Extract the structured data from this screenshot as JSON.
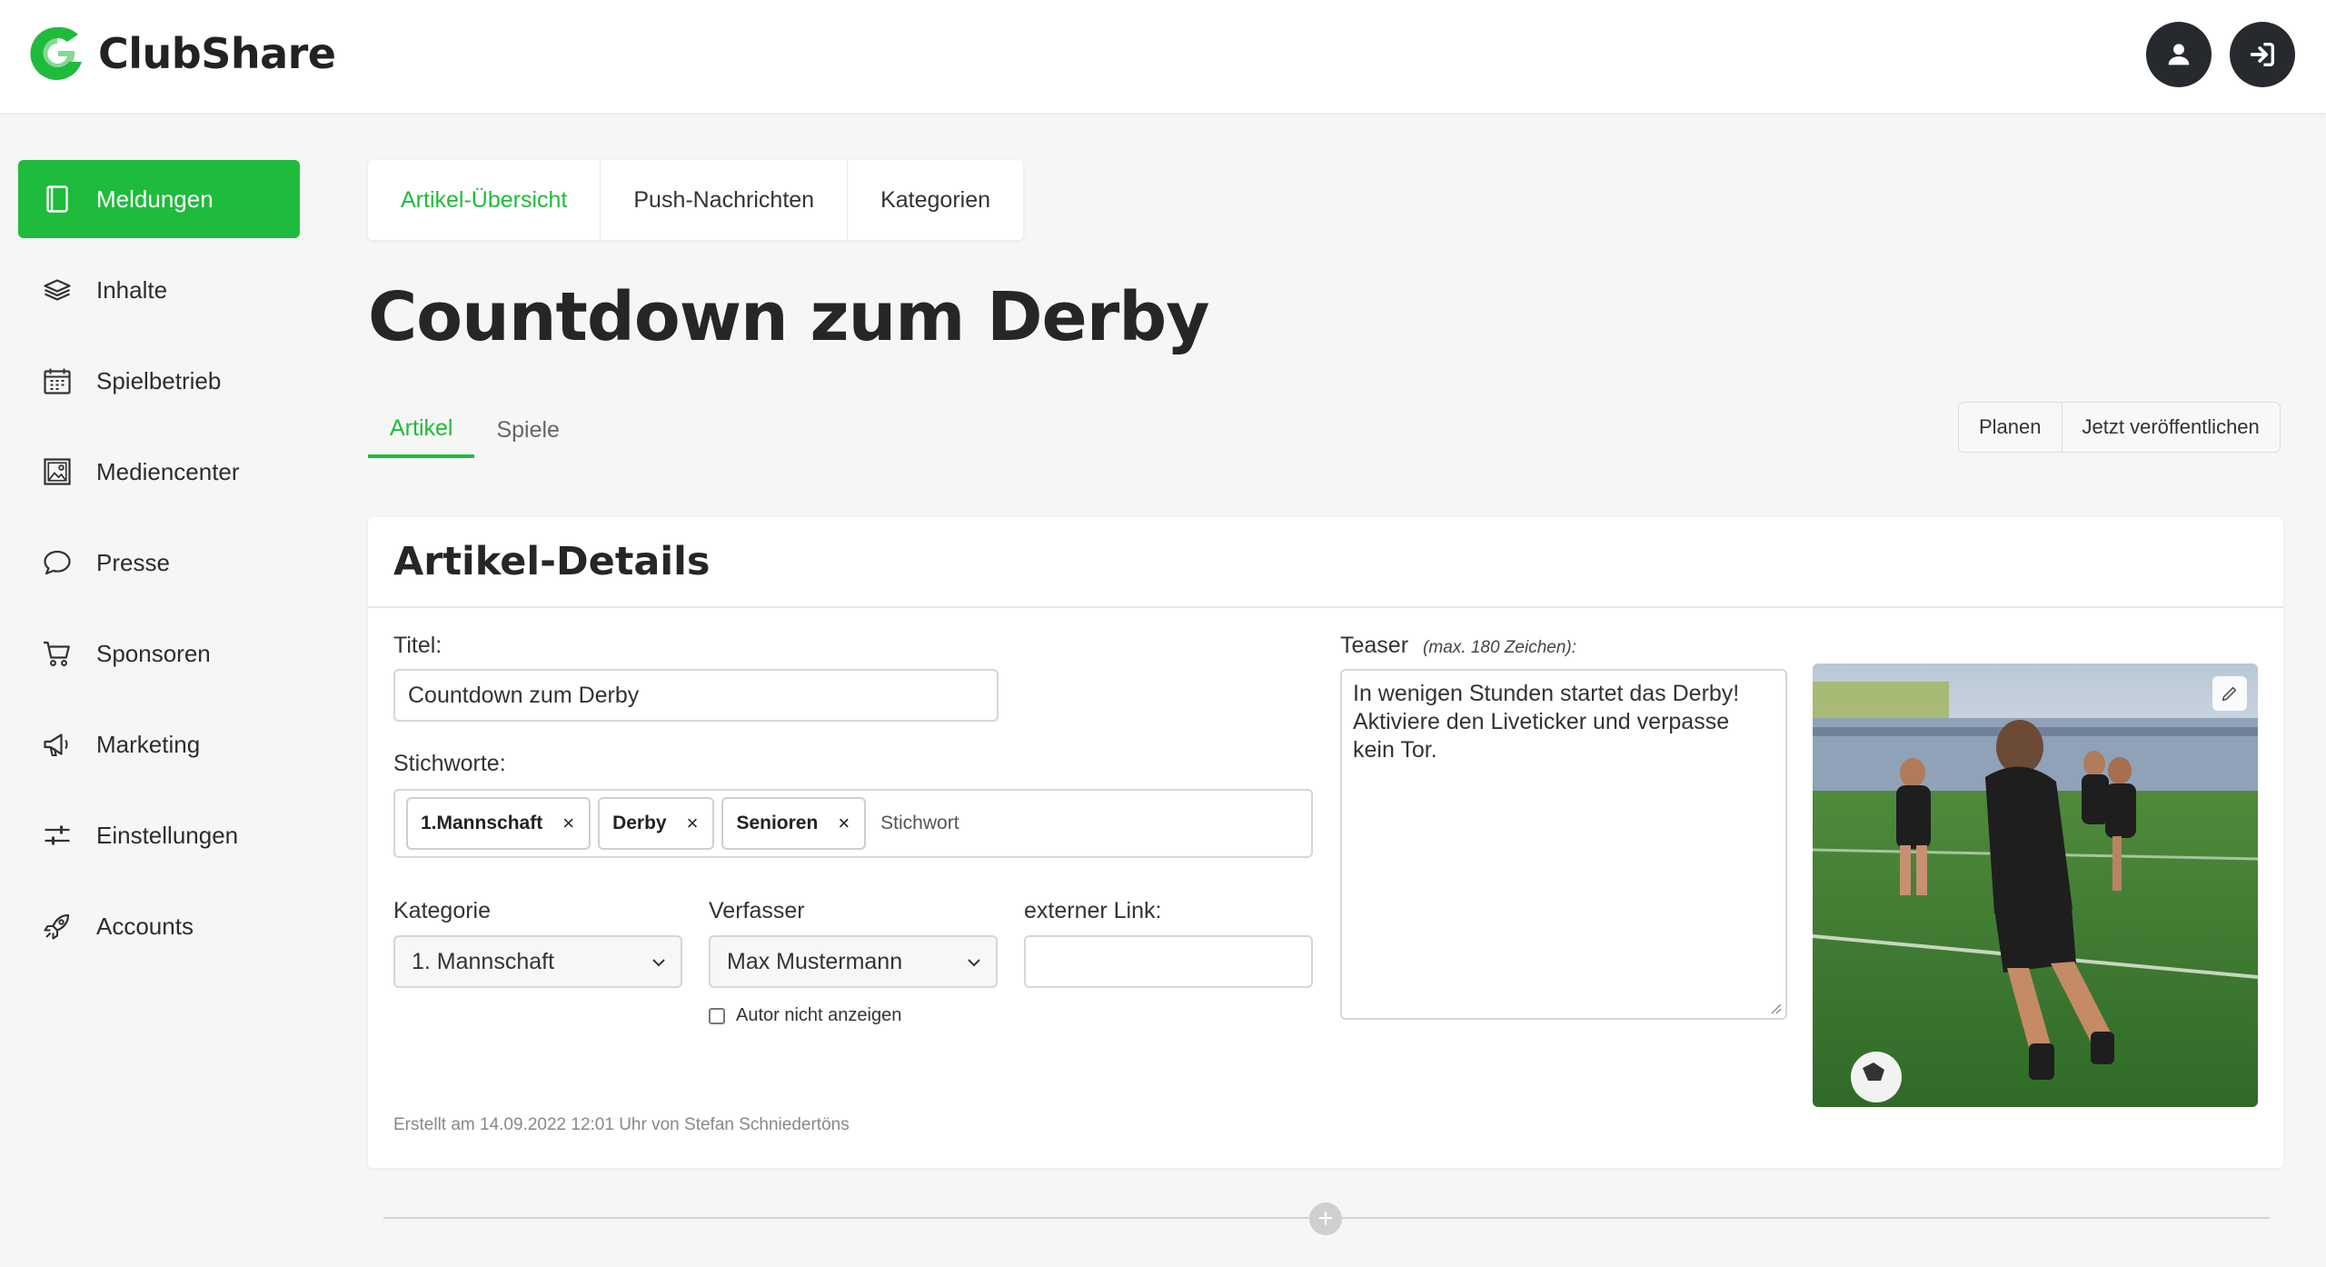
{
  "app": {
    "name": "ClubShare",
    "brand_color": "#1fbb3c"
  },
  "header": {
    "profile_icon": "user-icon",
    "logout_icon": "logout-icon"
  },
  "sidebar": {
    "items": [
      {
        "label": "Meldungen",
        "icon": "book-icon",
        "active": true
      },
      {
        "label": "Inhalte",
        "icon": "layers-icon"
      },
      {
        "label": "Spielbetrieb",
        "icon": "calendar-icon"
      },
      {
        "label": "Mediencenter",
        "icon": "image-icon"
      },
      {
        "label": "Presse",
        "icon": "chat-bubble-icon"
      },
      {
        "label": "Sponsoren",
        "icon": "cart-icon"
      },
      {
        "label": "Marketing",
        "icon": "megaphone-icon"
      },
      {
        "label": "Einstellungen",
        "icon": "sliders-icon"
      },
      {
        "label": "Accounts",
        "icon": "rocket-icon"
      }
    ]
  },
  "top_tabs": [
    "Artikel-Übersicht",
    "Push-Nachrichten",
    "Kategorien"
  ],
  "page_title": "Countdown zum Derby",
  "sub_tabs": [
    "Artikel",
    "Spiele"
  ],
  "actions": {
    "schedule": "Planen",
    "publish": "Jetzt veröffentlichen"
  },
  "card": {
    "title": "Artikel-Details",
    "title_label": "Titel:",
    "title_value": "Countdown zum Derby",
    "keywords_label": "Stichworte:",
    "keywords": [
      "1.Mannschaft",
      "Derby",
      "Senioren"
    ],
    "keywords_placeholder": "Stichwort",
    "category_label": "Kategorie",
    "category_value": "1. Mannschaft",
    "author_label": "Verfasser",
    "author_value": "Max Mustermann",
    "hide_author_label": "Autor nicht anzeigen",
    "link_label": "externer Link:",
    "link_value": "",
    "teaser_label": "Teaser",
    "teaser_hint": "(max. 180 Zeichen):",
    "teaser_value": "In wenigen Stunden startet das Derby! Aktiviere den Liveticker und verpasse kein Tor.",
    "created_meta": "Erstellt am 14.09.2022 12:01 Uhr von Stefan Schniedertöns"
  }
}
